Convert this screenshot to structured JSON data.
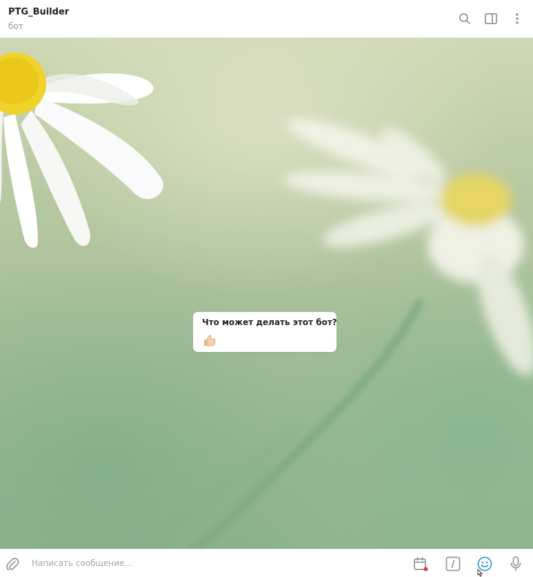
{
  "header": {
    "title": "PTG_Builder",
    "status": "бот",
    "icons": [
      "search-icon",
      "side-panel-icon",
      "more-vertical-icon"
    ]
  },
  "chat": {
    "background": "daisy-flowers-wallpaper",
    "message": {
      "text": "Что может делать этот бот?",
      "emoji": "👍🏻"
    }
  },
  "composer": {
    "placeholder": "Написать сообщение...",
    "icons": [
      "paperclip-icon",
      "schedule-calendar-icon",
      "bot-commands-icon",
      "emoji-icon",
      "microphone-icon"
    ]
  },
  "colors": {
    "accent": "#3a9bd2",
    "icon": "#8f969c",
    "badge": "#e53935"
  }
}
